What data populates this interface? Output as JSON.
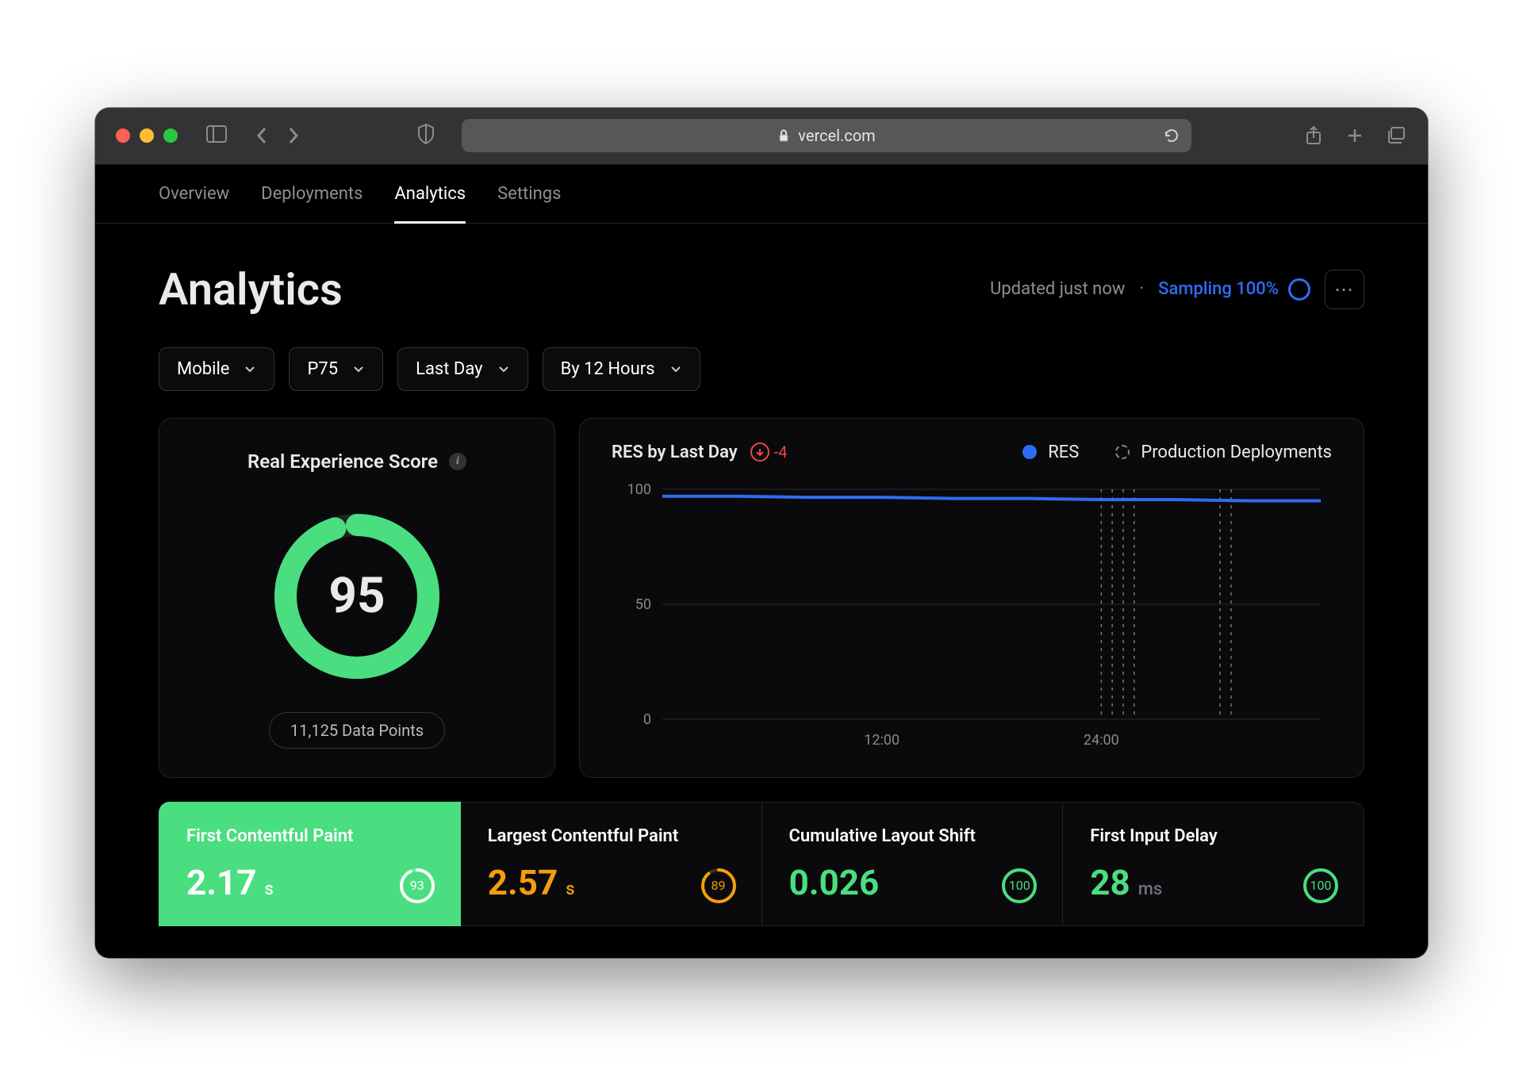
{
  "browser": {
    "url_host": "vercel.com"
  },
  "tabs": [
    "Overview",
    "Deployments",
    "Analytics",
    "Settings"
  ],
  "active_tab_index": 2,
  "page_title": "Analytics",
  "header": {
    "updated": "Updated just now",
    "sampling_label": "Sampling 100%"
  },
  "filters": {
    "device": "Mobile",
    "percentile": "P75",
    "range": "Last Day",
    "bucket": "By 12 Hours"
  },
  "score_card": {
    "title": "Real Experience Score",
    "value": "95",
    "value_num": 95,
    "data_points": "11,125 Data Points"
  },
  "res_chart": {
    "title": "RES by Last Day",
    "delta": "-4",
    "legend_res": "RES",
    "legend_deploy": "Production Deployments"
  },
  "chart_data": {
    "type": "line",
    "title": "RES by Last Day",
    "xlabel": "",
    "ylabel": "",
    "ylim": [
      0,
      100
    ],
    "y_ticks": [
      0,
      50,
      100
    ],
    "x_ticks": [
      "12:00",
      "24:00"
    ],
    "x": [
      0,
      4,
      8,
      12,
      16,
      20,
      24,
      28,
      32,
      36
    ],
    "series": [
      {
        "name": "RES",
        "values": [
          97,
          97,
          96.5,
          96.5,
          96,
          96,
          95.5,
          95.5,
          95,
          95
        ]
      }
    ],
    "deployment_markers_x": [
      24.0,
      24.6,
      25.2,
      25.8,
      30.5,
      31.1
    ]
  },
  "metrics": [
    {
      "name": "First Contentful Paint",
      "value": "2.17",
      "unit": "s",
      "score": "93",
      "score_num": 93,
      "style": "active"
    },
    {
      "name": "Largest Contentful Paint",
      "value": "2.57",
      "unit": "s",
      "score": "89",
      "score_num": 89,
      "style": "orange"
    },
    {
      "name": "Cumulative Layout Shift",
      "value": "0.026",
      "unit": "",
      "score": "100",
      "score_num": 100,
      "style": "green"
    },
    {
      "name": "First Input Delay",
      "value": "28",
      "unit": "ms",
      "score": "100",
      "score_num": 100,
      "style": "green"
    }
  ]
}
